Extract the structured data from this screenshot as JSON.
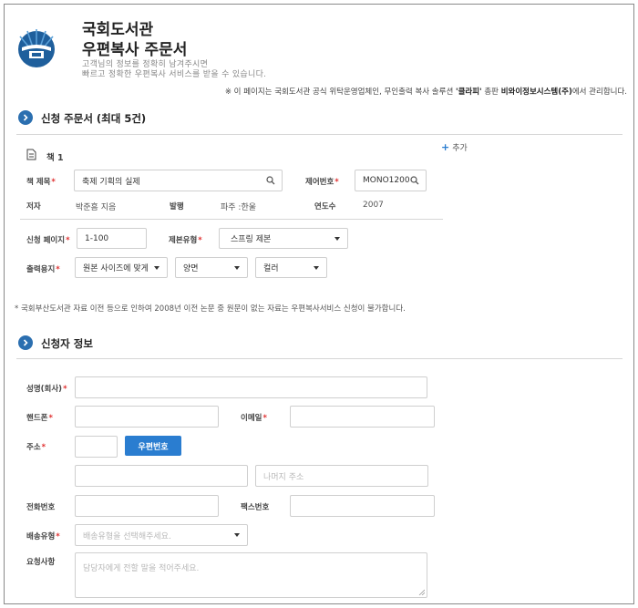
{
  "header": {
    "title_line1": "국회도서관",
    "title_line2": "우편복사 주문서",
    "subtitle_line1": "고객님의 정보를 정확히 남겨주시면",
    "subtitle_line2": "빠르고 정확한 우편복사 서비스를 받을 수 있습니다.",
    "notice_prefix": "※ 이 페이지는 국회도서관 공식 위탁운영업체인, 무인출력 복사 솔루션 ",
    "notice_brand": "'클라피'",
    "notice_mid": " 총판 ",
    "notice_company": "비와이정보시스템(주)",
    "notice_suffix": "에서 관리합니다."
  },
  "order_section": {
    "title": "신청 주문서 (최대 5건)",
    "add_label": "추가",
    "book_label": "책 1",
    "fields": {
      "book_title_label": "책 제목",
      "book_title_value": "축제 기획의 실제",
      "control_no_label": "제어번호",
      "control_no_value": "MONO1200",
      "author_label": "저자",
      "author_value": "박준흠 지음",
      "publisher_label": "발행",
      "publisher_value": "파주 :한울",
      "year_label": "연도수",
      "year_value": "2007",
      "pages_label": "신청 페이지",
      "pages_value": "1-100",
      "binding_label": "제본유형",
      "binding_value": "스프링 제본",
      "paper_label": "출력용지",
      "paper_size_value": "원본 사이즈에 맞게",
      "sides_value": "양면",
      "color_value": "컬러"
    },
    "footnote": "* 국회부산도서관 자료 이전 등으로 인하여 2008년 이전 논문 중 원문이 없는 자료는 우편복사서비스 신청이 불가합니다."
  },
  "applicant_section": {
    "title": "신청자 정보",
    "name_label": "성명(회사)",
    "phone_label": "핸드폰",
    "email_label": "이메일",
    "address_label": "주소",
    "zipcode_button": "우편번호",
    "address_detail_placeholder": "나머지 주소",
    "tel_label": "전화번호",
    "fax_label": "팩스번호",
    "delivery_label": "배송유형",
    "delivery_placeholder": "배송유형을 선택해주세요.",
    "request_label": "요청사항",
    "request_placeholder": "담당자에게 전할 말을 적어주세요."
  },
  "colors": {
    "accent": "#2a7dd0",
    "section_icon": "#2b6fb0",
    "required": "#e03030"
  }
}
